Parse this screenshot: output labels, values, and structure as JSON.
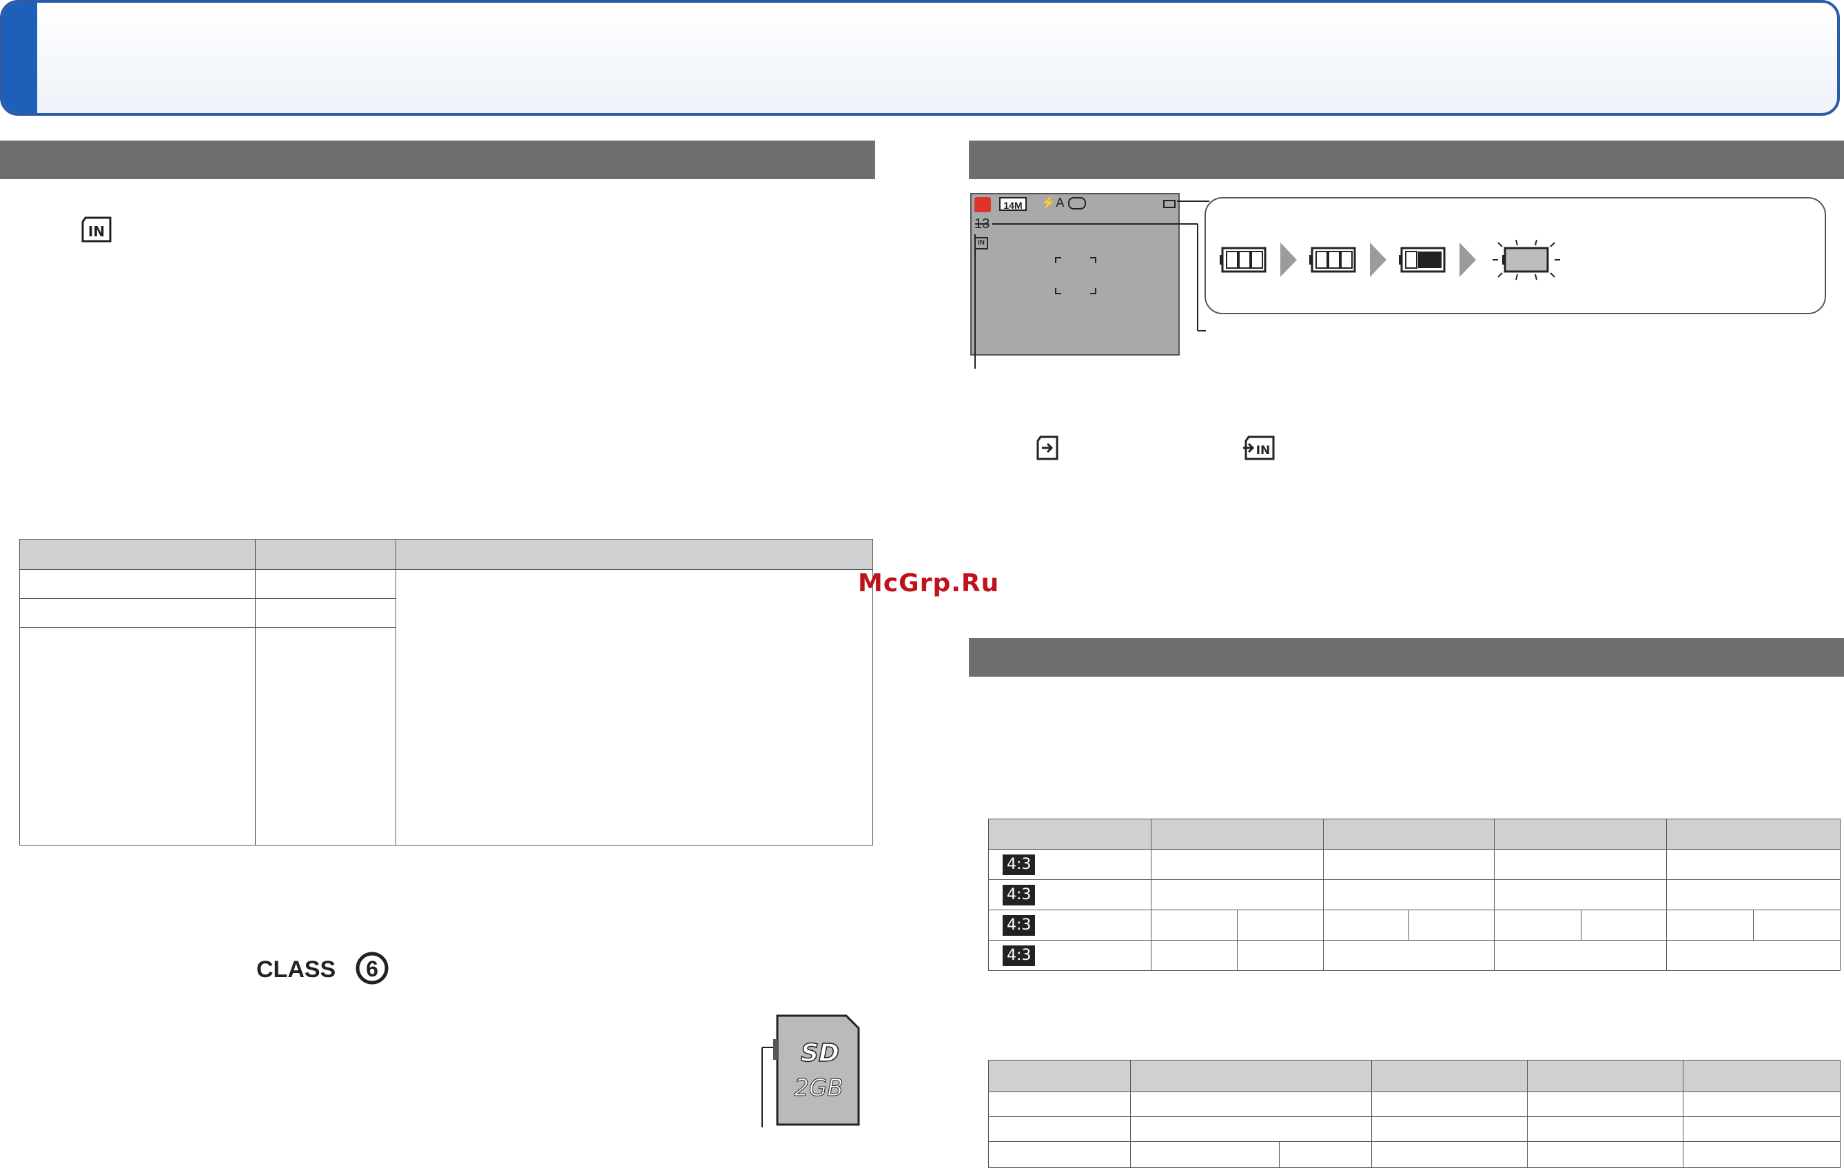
{
  "watermark": "McGrp.Ru",
  "icons": {
    "internal_memory": "internal-memory-icon",
    "card_icon": "card-icon",
    "copy_to_internal": "copy-to-internal-icon",
    "sd_class": "sd-class-6-logo",
    "sd_card": "sd-card-illustration"
  },
  "camera_display": {
    "mode_badge": "14M",
    "flash": "⚡A",
    "remaining_count": "13"
  },
  "sd_card_label": "2GB",
  "table2_aspect_badge": "4:3",
  "colors": {
    "accent": "#1e5fb8",
    "section_bar": "#6e6f71",
    "table_head": "#cfd0d2"
  }
}
